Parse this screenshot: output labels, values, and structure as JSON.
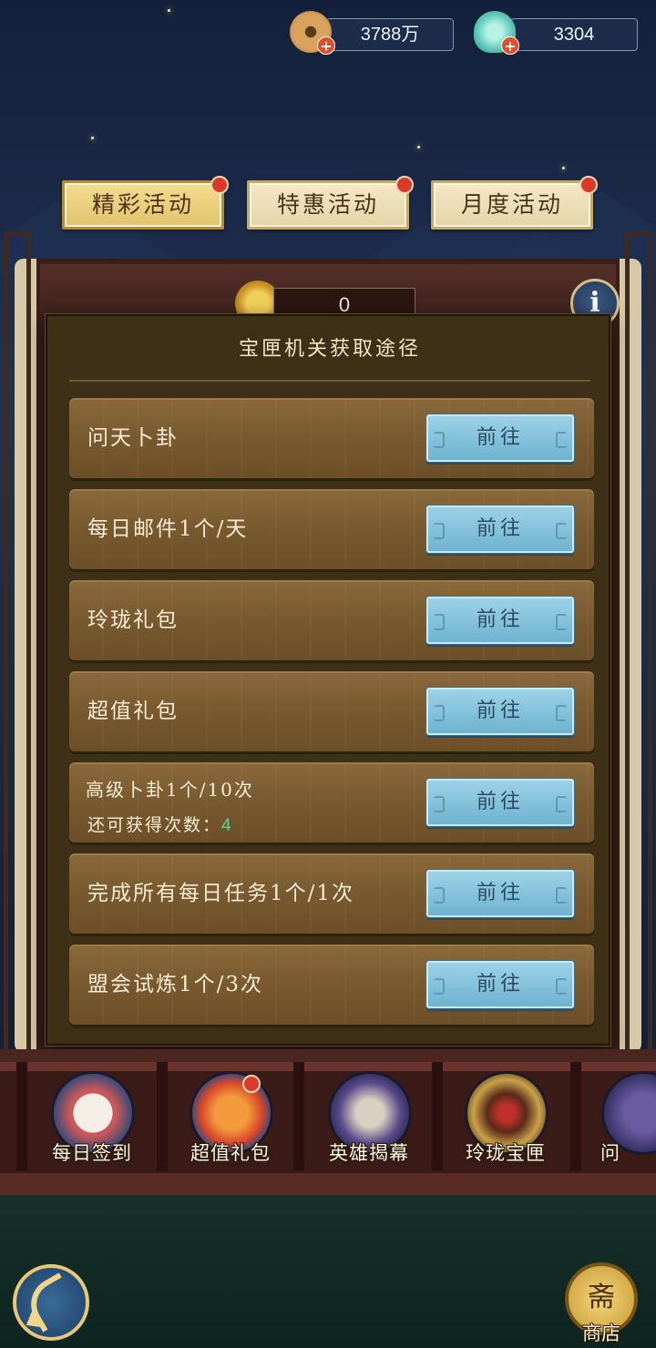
{
  "currencies": [
    {
      "value": "3788万",
      "icon": "copper-coin-icon",
      "color": "#c98a3e"
    },
    {
      "value": "3304",
      "icon": "jade-shell-icon",
      "color": "#6fd4c0"
    }
  ],
  "category_tabs": [
    {
      "label": "精彩活动",
      "active": true
    },
    {
      "label": "特惠活动",
      "active": false
    },
    {
      "label": "月度活动",
      "active": false
    }
  ],
  "event_header": {
    "token_count": "0",
    "info_label": "i"
  },
  "modal": {
    "title": "宝匣机关获取途径",
    "rows": [
      {
        "label": "问天卜卦",
        "button": "前往"
      },
      {
        "label": "每日邮件1个/天",
        "button": "前往"
      },
      {
        "label": "玲珑礼包",
        "button": "前往"
      },
      {
        "label": "超值礼包",
        "button": "前往"
      },
      {
        "label": "高级卜卦1个/10次",
        "sub_label": "还可获得次数：",
        "sub_value": "4",
        "button": "前往"
      },
      {
        "label": "完成所有每日任务1个/1次",
        "button": "前往"
      },
      {
        "label": "盟会试炼1个/3次",
        "button": "前往"
      }
    ]
  },
  "bottom_features": [
    {
      "label": "每日签到",
      "icon": "calendar-scroll-icon",
      "badge": false
    },
    {
      "label": "超值礼包",
      "icon": "gift-bag-icon",
      "badge": true
    },
    {
      "label": "英雄揭幕",
      "icon": "hero-portrait-icon",
      "badge": false
    },
    {
      "label": "玲珑宝匣",
      "icon": "treasure-box-icon",
      "badge": false
    },
    {
      "label": "问",
      "icon": "partial-feature-icon",
      "badge": false
    }
  ],
  "footer": {
    "shop_label": "商店",
    "shop_glyph": "斋",
    "back_icon": "back-arrow-icon"
  },
  "colors": {
    "accent_gold": "#e2c36d",
    "button_blue": "#8cc6de",
    "badge_red": "#d93a2c",
    "highlight_green": "#5ed59a"
  }
}
